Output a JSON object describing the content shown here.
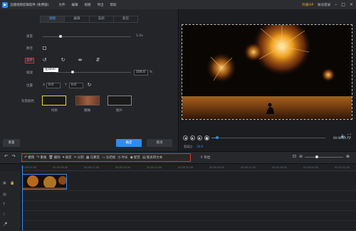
{
  "app": {
    "title": "迅捷视频剪辑软件 (免费版)"
  },
  "menu": [
    "文件",
    "编辑",
    "视图",
    "导出",
    "帮助"
  ],
  "topright": {
    "vip": "开通VIP",
    "login": "账号登录"
  },
  "tabs": [
    {
      "label": "视频",
      "active": true
    },
    {
      "label": "编辑",
      "active": false
    },
    {
      "label": "美颜",
      "active": false
    },
    {
      "label": "裁剪",
      "active": false
    }
  ],
  "settings": {
    "speed_label": "速度",
    "speed_value": "1.0x",
    "speed_level": 0.2,
    "mute_label": "静音",
    "rotate_label": "旋转",
    "rotate_tooltip": "左转90°",
    "scale_label": "缩放",
    "scale_value": "100.0",
    "scale_unit": "%",
    "scale_level": 0.23,
    "position_label": "位置",
    "x_label": "X",
    "x_value": "0.0",
    "y_label": "Y",
    "y_value": "0.0",
    "bg_label": "背景颜色",
    "bg_options": [
      "纯色",
      "模糊",
      "图片"
    ]
  },
  "buttons": {
    "reset": "重置",
    "confirm": "确定",
    "cancel": "取消"
  },
  "player": {
    "timecode": "00:00:13.72",
    "aspect_label": "宽高比：",
    "aspect_value": "16:9",
    "progress": 0.05
  },
  "toolbar": {
    "tools": [
      "撤销",
      "重做",
      "删除",
      "裁剪",
      "分割",
      "马赛克",
      "冻结帧",
      "时长",
      "配音",
      "图表转文本"
    ],
    "export_label": "导出"
  },
  "ruler_ticks": [
    "00:00:00.00",
    "00:00:06.00",
    "00:00:12.00",
    "00:00:18.00",
    "00:00:24.00",
    "00:00:30.00",
    "00:00:36.00",
    "00:00:42.00",
    "00:00:48.00",
    "00:00:54.00",
    "00:01:00.00"
  ],
  "colors": {
    "accent": "#2d8cf0",
    "highlight": "#e03030"
  }
}
